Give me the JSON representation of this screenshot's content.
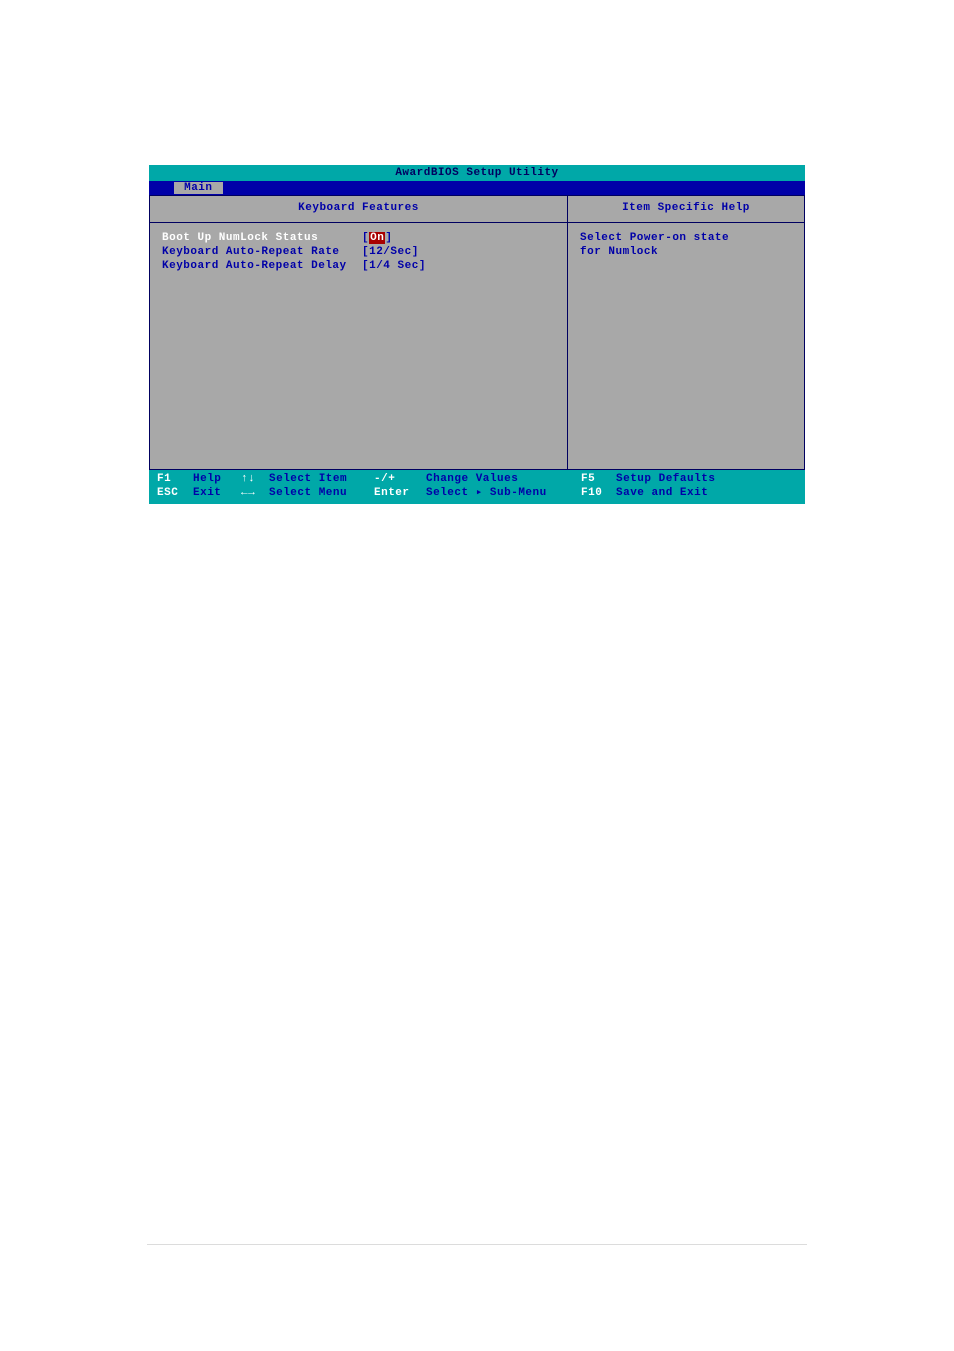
{
  "title": "AwardBIOS Setup Utility",
  "menu": {
    "active_tab": "Main"
  },
  "left_panel": {
    "header": "Keyboard Features",
    "settings": [
      {
        "label": "Boot Up NumLock Status",
        "value": "On",
        "selected": true
      },
      {
        "label": "Keyboard Auto-Repeat Rate",
        "value": "12/Sec",
        "selected": false
      },
      {
        "label": "Keyboard Auto-Repeat Delay",
        "value": "1/4 Sec",
        "selected": false
      }
    ]
  },
  "right_panel": {
    "header": "Item Specific Help",
    "help_line1": "Select Power-on state",
    "help_line2": "for Numlock"
  },
  "footer": {
    "row1": {
      "k1": "F1",
      "a1": "Help",
      "k2": "↑↓",
      "a2": "Select Item",
      "k3": "-/+",
      "a3": "Change Values",
      "k4": "F5",
      "a4": "Setup Defaults"
    },
    "row2": {
      "k1": "ESC",
      "a1": "Exit",
      "k2": "←→",
      "a2": "Select Menu",
      "k3": "Enter",
      "a3": "Select ▸ Sub-Menu",
      "k4": "F10",
      "a4": "Save and Exit"
    }
  }
}
